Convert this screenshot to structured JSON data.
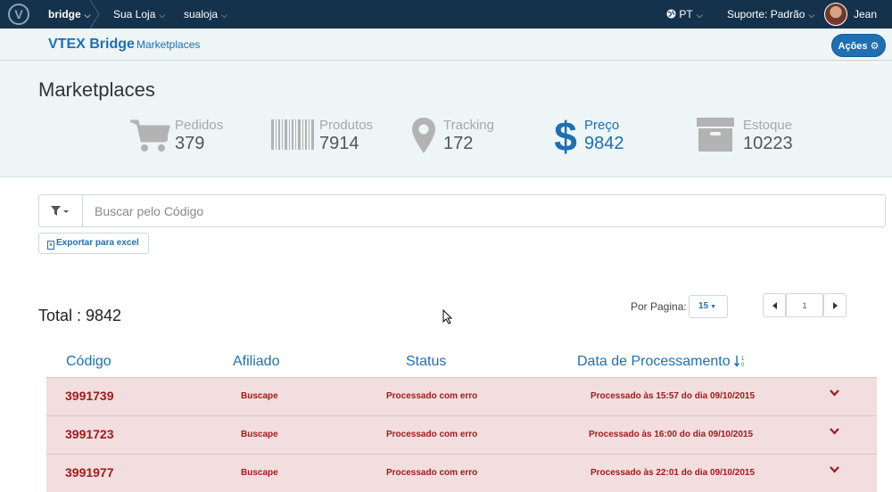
{
  "topbar": {
    "logo": "V",
    "crumbs": [
      {
        "label": "bridge",
        "icon": "chevron-down-icon"
      },
      {
        "label": "Sua Loja",
        "icon": "chevron-down-icon"
      },
      {
        "label": "sualoja",
        "icon": "chevron-down-icon"
      }
    ],
    "language": "PT",
    "support_label": "Suporte:",
    "support_value": "Padrão",
    "user_name": "Jean"
  },
  "subbar": {
    "brand": "VTEX Bridge",
    "nav_link": "Marketplaces",
    "actions_label": "Ações"
  },
  "stats": {
    "title": "Marketplaces",
    "items": [
      {
        "label": "Pedidos",
        "value": "379",
        "icon": "cart-icon"
      },
      {
        "label": "Produtos",
        "value": "7914",
        "icon": "barcode-icon"
      },
      {
        "label": "Tracking",
        "value": "172",
        "icon": "map-marker-icon"
      },
      {
        "label": "Preço",
        "value": "9842",
        "icon": "dollar-icon",
        "active": true
      },
      {
        "label": "Estoque",
        "value": "10223",
        "icon": "archive-box-icon"
      }
    ]
  },
  "search": {
    "placeholder": "Buscar pelo Código"
  },
  "export_label": "Exportar para excel",
  "total_label": "Total : 9842",
  "pagination": {
    "per_page_label": "Por Pagina:",
    "per_page_value": "15",
    "current_page": "1"
  },
  "table": {
    "headers": [
      "Código",
      "Afiliado",
      "Status",
      "Data de Processamento"
    ],
    "rows": [
      {
        "code": "3991739",
        "affiliate": "Buscape",
        "status": "Processado com erro",
        "date": "Processado às 15:57 do dia 09/10/2015"
      },
      {
        "code": "3991723",
        "affiliate": "Buscape",
        "status": "Processado com erro",
        "date": "Processado às 16:00 do dia 09/10/2015"
      },
      {
        "code": "3991977",
        "affiliate": "Buscape",
        "status": "Processado com erro",
        "date": "Processado às 22:01 do dia 09/10/2015"
      }
    ]
  },
  "colors": {
    "topbar": "#14324c",
    "accent": "#1f6fb2",
    "error_row": "#f2dede",
    "error_text": "#a11b1b"
  }
}
